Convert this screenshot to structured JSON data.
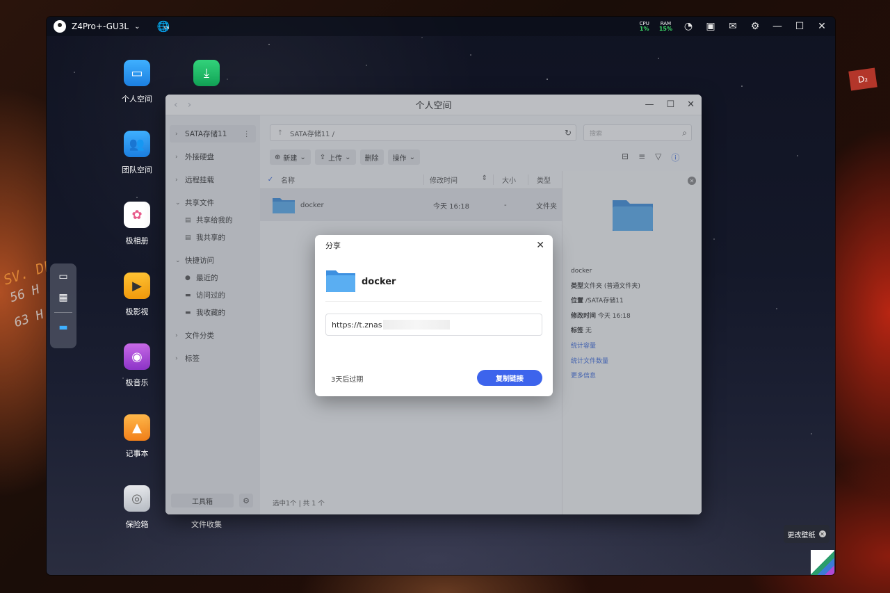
{
  "device": {
    "name": "Z4Pro+-GU3L",
    "v6_badge": "V6"
  },
  "system": {
    "cpu_label": "CPU",
    "cpu_value": "1%",
    "ram_label": "RAM",
    "ram_value": "15%"
  },
  "desktop_icons": [
    {
      "label": "个人空间"
    },
    {
      "label": "团队空间"
    },
    {
      "label": "极相册"
    },
    {
      "label": "极影视"
    },
    {
      "label": "极音乐"
    },
    {
      "label": "记事本"
    },
    {
      "label": "保险箱"
    },
    {
      "label": "文件收集"
    }
  ],
  "wallpaper": {
    "change_label": "更改壁纸",
    "decor_texts": [
      "SV. DF",
      "56 H",
      "63 H"
    ],
    "badge": "D₂"
  },
  "file_manager": {
    "title": "个人空间",
    "sidebar": {
      "storage": "SATA存储11",
      "external": "外接硬盘",
      "remote": "远程挂载",
      "shared": "共享文件",
      "shared_with_me": "共享给我的",
      "my_shares": "我共享的",
      "quick": "快捷访问",
      "recent": "最近的",
      "visited": "访问过的",
      "favorites": "我收藏的",
      "categories": "文件分类",
      "tags": "标签",
      "toolbox": "工具箱"
    },
    "path": "SATA存储11 /",
    "search_placeholder": "搜索",
    "actions": {
      "new": "新建",
      "upload": "上传",
      "delete": "删除",
      "operate": "操作"
    },
    "columns": {
      "name": "名称",
      "modified": "修改时间",
      "size": "大小",
      "type": "类型"
    },
    "rows": [
      {
        "name": "docker",
        "modified": "今天 16:18",
        "size": "-",
        "type": "文件夹"
      }
    ],
    "status": "选中1个 | 共 1 个",
    "info": {
      "name": "docker",
      "type_label": "类型",
      "type_value": "文件夹 (普通文件夹)",
      "location_label": "位置",
      "location_value": "/SATA存储11",
      "modified_label": "修改时间",
      "modified_value": "今天 16:18",
      "tag_label": "标签",
      "tag_value": "无",
      "link_capacity": "统计容量",
      "link_count": "统计文件数量",
      "link_more": "更多信息"
    }
  },
  "share_dialog": {
    "title": "分享",
    "file_name": "docker",
    "link_visible": "https://t.znas",
    "expiry": "3天后过期",
    "copy_button": "复制链接"
  },
  "colors": {
    "accent": "#3d64ec",
    "folder": "#4fa3f0",
    "stat_green": "#3ee06a"
  }
}
